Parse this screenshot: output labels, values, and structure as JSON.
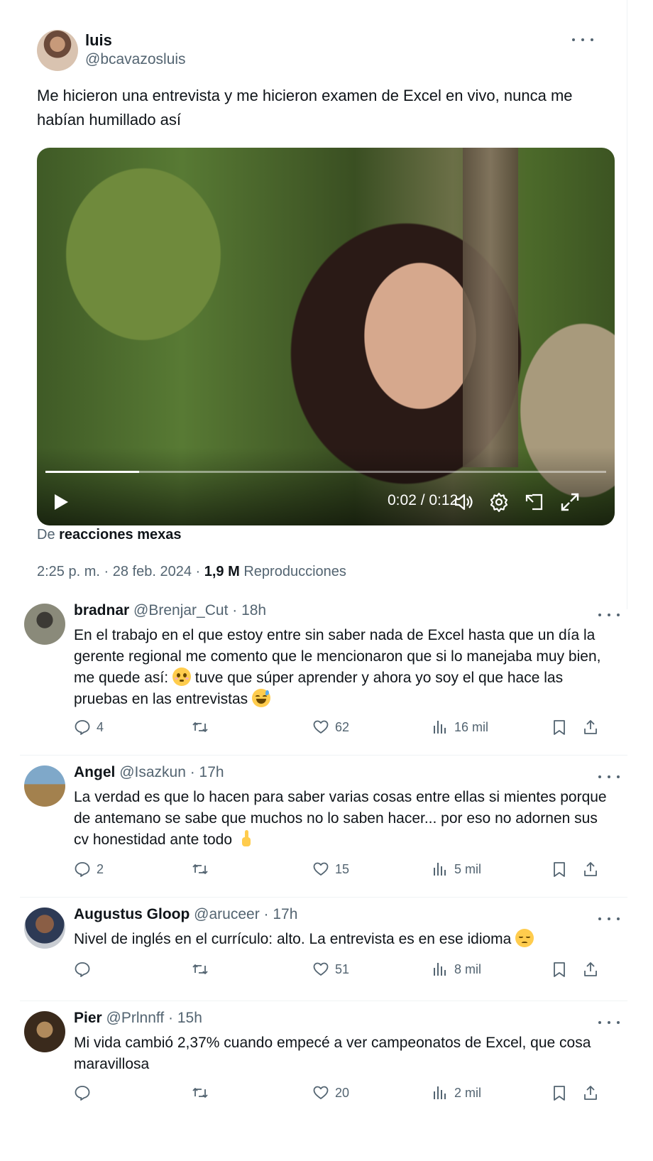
{
  "tweet": {
    "name": "luis",
    "handle": "@bcavazosluis",
    "text": "Me hicieron una entrevista y me hicieron examen de Excel en vivo, nunca me habían humillado así",
    "video": {
      "time": "0:02 / 0:12",
      "progress": 0.167
    },
    "source_prefix": "De",
    "source_name": "reacciones mexas",
    "time": "2:25 p. m.",
    "sep1": "·",
    "date": "28 feb. 2024",
    "sep2": "·",
    "views": "1,9 M",
    "views_label": "Reproducciones"
  },
  "replies": [
    {
      "name": "bradnar",
      "meta": "@Brenjar_Cut · 18h",
      "text_a": "En el trabajo en el que estoy entre sin saber nada de Excel hasta que un día la gerente regional me comento que le mencionaron que si lo manejaba muy bien, me quede así: ",
      "text_b": " tuve que súper aprender y ahora yo soy el que hace las pruebas en las entrevistas ",
      "replies": "4",
      "reposts": "",
      "likes": "62",
      "views": "16 mil"
    },
    {
      "name": "Angel",
      "meta": "@Isazkun · 17h",
      "text_a": "La verdad es que lo hacen para saber varias cosas entre ellas si mientes porque de antemano se sabe que muchos no lo saben hacer... por eso no adornen sus cv honestidad ante todo ",
      "replies": "2",
      "reposts": "",
      "likes": "15",
      "views": "5 mil"
    },
    {
      "name": "Augustus Gloop",
      "meta": "@aruceer · 17h",
      "text_a": "Nivel de inglés en el currículo: alto. La entrevista es en ese idioma ",
      "replies": "",
      "reposts": "",
      "likes": "51",
      "views": "8 mil"
    },
    {
      "name": "Pier",
      "meta": "@Prlnnff · 15h",
      "text_a": "Mi vida cambió 2,37% cuando empecé a ver campeonatos de Excel, que cosa maravillosa",
      "replies": "",
      "reposts": "",
      "likes": "20",
      "views": "2 mil"
    }
  ],
  "icons": {
    "more": "more-icon",
    "reply": "reply-icon",
    "repost": "repost-icon",
    "like": "heart-icon",
    "views": "views-icon",
    "bookmark": "bookmark-icon",
    "share": "share-icon"
  }
}
